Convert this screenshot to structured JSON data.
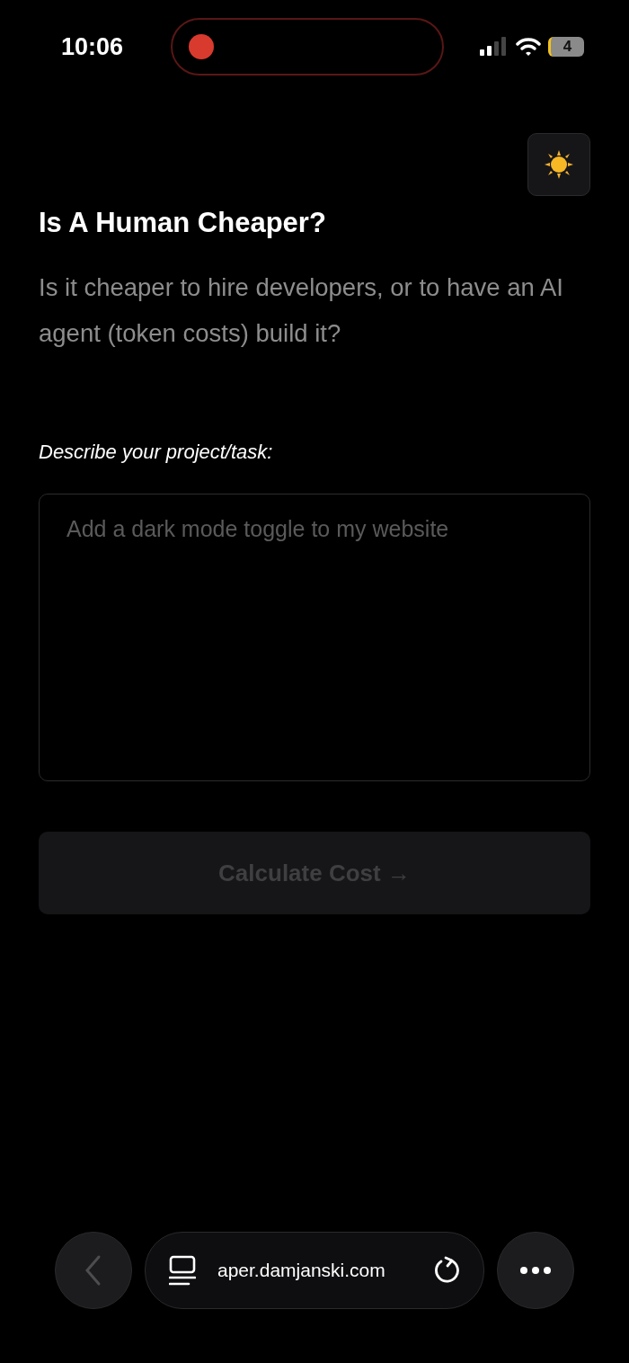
{
  "status_bar": {
    "time": "10:06",
    "recording": true,
    "battery": "4"
  },
  "title": "Is A Human Cheaper?",
  "subtitle": "Is it cheaper to hire developers, or to have an AI agent (token costs) build it?",
  "form": {
    "label": "Describe your project/task:",
    "placeholder": "Add a dark mode toggle to my website",
    "button": {
      "label": "Calculate Cost →",
      "disabled": true
    }
  },
  "browser_bar": {
    "back_disabled": true,
    "url": "aper.damjanski.com"
  }
}
